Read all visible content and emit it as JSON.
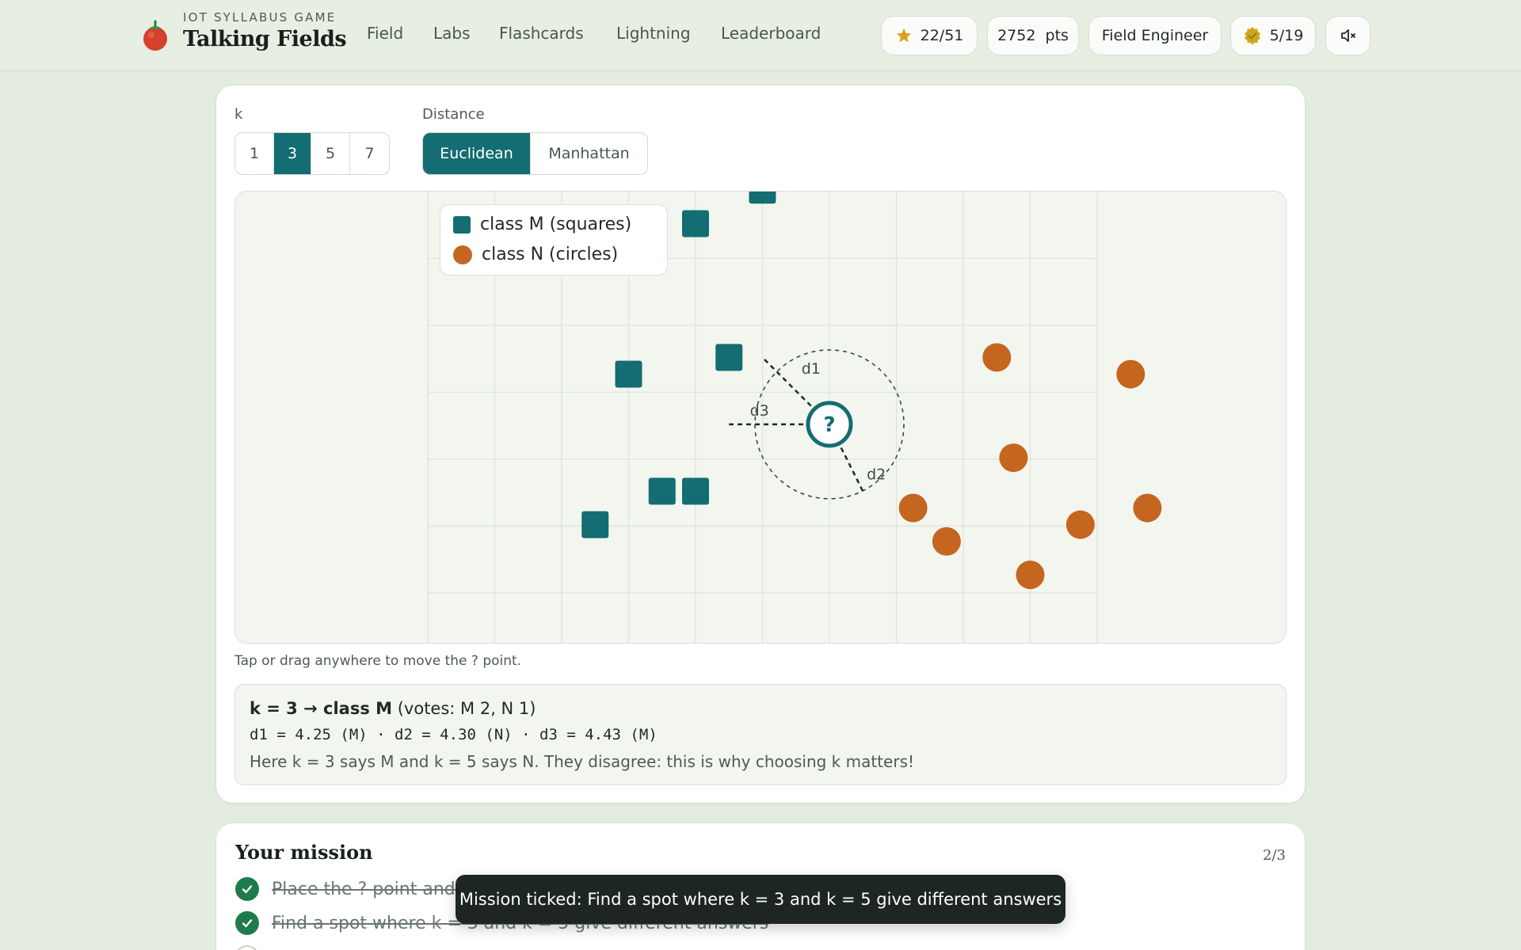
{
  "brand": {
    "subtitle": "IOT SYLLABUS GAME",
    "title": "Talking Fields"
  },
  "nav": [
    "Field",
    "Labs",
    "Flashcards",
    "Lightning",
    "Leaderboard"
  ],
  "stats": {
    "stars": "22/51",
    "points": "2752  pts",
    "rank": "Field Engineer",
    "badges": "5/19"
  },
  "icons": {
    "star": "star-icon",
    "badge": "badge-icon",
    "mute": "speaker-muted-icon",
    "brand": "tomato-icon"
  },
  "controls": {
    "k_label": "k",
    "k_options": [
      "1",
      "3",
      "5",
      "7"
    ],
    "k_selected": "3",
    "distance_label": "Distance",
    "distance_options": [
      "Euclidean",
      "Manhattan"
    ],
    "distance_selected": "Euclidean"
  },
  "plot": {
    "legend": {
      "m": "class M (squares)",
      "n": "class N (circles)"
    },
    "query_label": "?",
    "distance_labels": [
      "d1",
      "d2",
      "d3"
    ],
    "class_m_points": [
      [
        4,
        3.5
      ],
      [
        3,
        3
      ],
      [
        3.5,
        1
      ],
      [
        2,
        0.75
      ],
      [
        3,
        -1
      ],
      [
        2.5,
        -1
      ],
      [
        1.5,
        -1.5
      ]
    ],
    "class_n_points": [
      [
        7.5,
        1
      ],
      [
        9.5,
        0.75
      ],
      [
        7.75,
        -0.5
      ],
      [
        6.25,
        -1.25
      ],
      [
        6.75,
        -1.75
      ],
      [
        8.75,
        -1.5
      ],
      [
        9.75,
        -1.25
      ],
      [
        8,
        -2.25
      ]
    ],
    "query_point": [
      5,
      0
    ],
    "neighbors": [
      [
        4,
        1
      ],
      [
        5.5,
        -1
      ],
      [
        3.5,
        0
      ]
    ],
    "colors": {
      "class_m": "#136d72",
      "class_n": "#c4661f"
    }
  },
  "hint": "Tap or drag anywhere to move the ? point.",
  "result": {
    "headline_bold": "k = 3 → class M",
    "headline_rest": " (votes: M 2, N 1)",
    "distances": "d1 = 4.25 (M) · d2 = 4.30 (N) · d3 = 4.43 (M)",
    "note": "Here k = 3 says M and k = 5 says N. They disagree: this is why choosing k matters!"
  },
  "mission": {
    "title": "Your mission",
    "progress": "2/3",
    "tasks": [
      {
        "text": "Place the ? point and c",
        "done": true
      },
      {
        "text": "Find a spot where k = 3 and k = 5 give different answers",
        "done": true
      }
    ]
  },
  "toast": "Mission ticked: Find a spot where k = 3 and k = 5 give different answers"
}
